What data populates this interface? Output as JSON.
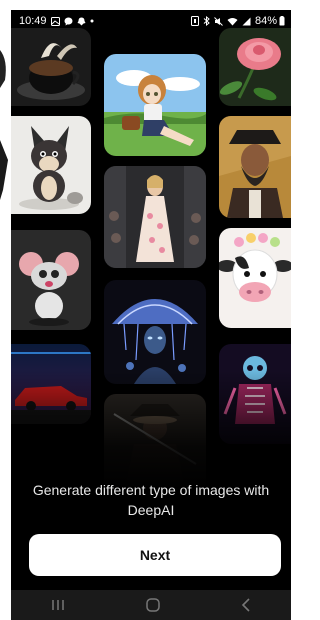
{
  "status_bar": {
    "time": "10:49",
    "battery_percent": "84%",
    "left_icons": [
      "gallery-icon",
      "messenger-icon",
      "snapchat-icon",
      "dot-icon"
    ],
    "right_icons": [
      "nfc-icon",
      "bluetooth-icon",
      "mute-icon",
      "wifi-icon",
      "signal-icon",
      "battery-icon"
    ]
  },
  "gallery": {
    "images": [
      "coffee-cup-image",
      "anime-girl-image",
      "rose-image",
      "cartoon-dog-image",
      "runway-model-image",
      "pirate-image",
      "cartoon-mouse-image",
      "jellyfish-woman-image",
      "cartoon-cow-image",
      "retro-car-image",
      "samurai-image",
      "neon-skeleton-image"
    ]
  },
  "onboarding": {
    "caption": "Generate different type of images with DeepAI",
    "next_label": "Next"
  },
  "nav_bar": {
    "icons": [
      "recent-apps-icon",
      "home-icon",
      "back-icon"
    ]
  }
}
